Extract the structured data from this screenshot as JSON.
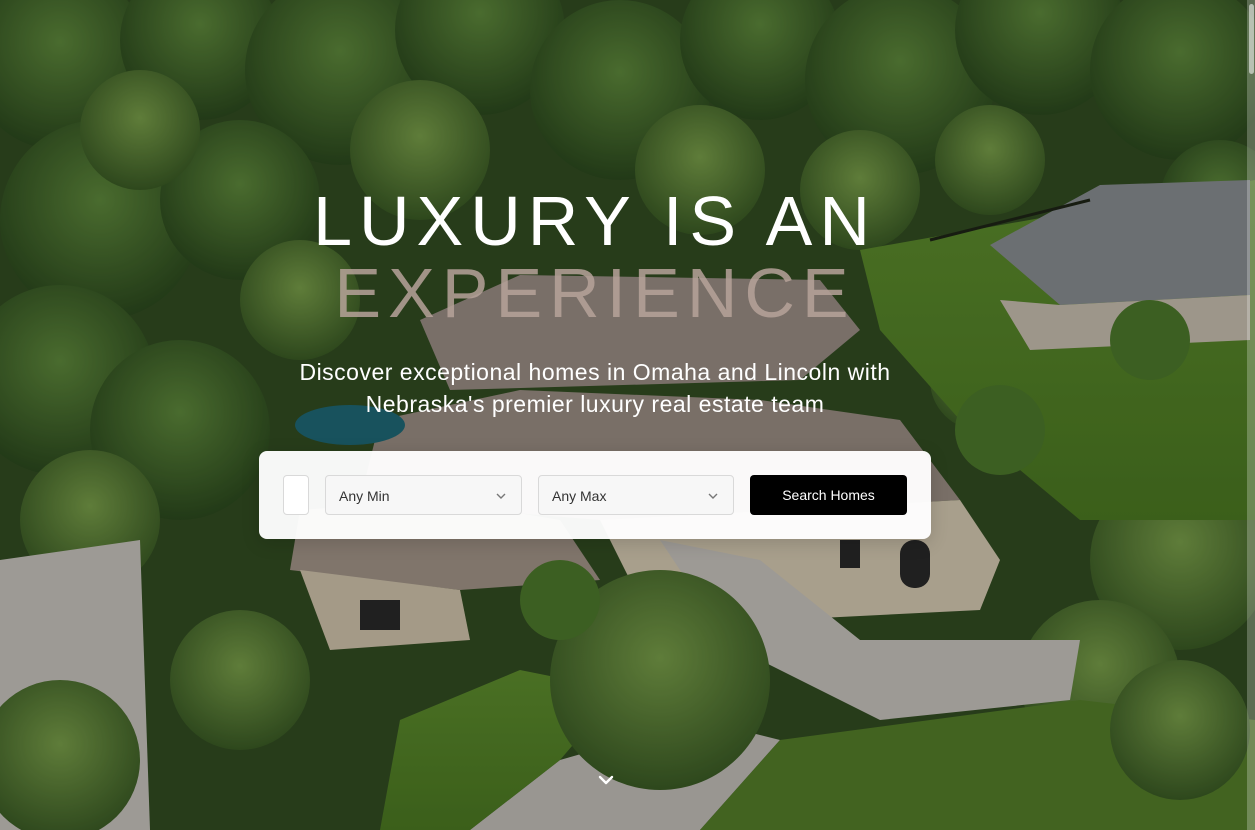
{
  "hero": {
    "headline_line1": "LUXURY IS AN",
    "headline_line2": "EXPERIENCE",
    "subtitle_line1": "Discover exceptional homes in Omaha and Lincoln with",
    "subtitle_line2": "Nebraska's premier luxury real estate team",
    "background_image": "aerial-luxury-home-icon"
  },
  "search": {
    "location_value": "",
    "min_price": {
      "selected": "Any Min"
    },
    "max_price": {
      "selected": "Any Max"
    },
    "submit_label": "Search Homes"
  },
  "icons": {
    "dropdown": "chevron-down-icon",
    "scroll": "chevron-down-icon"
  },
  "colors": {
    "headline_primary": "#ffffff",
    "headline_accent": "#b7a39a",
    "button_bg": "#000000",
    "button_text": "#ffffff",
    "panel_bg": "#ffffff"
  }
}
